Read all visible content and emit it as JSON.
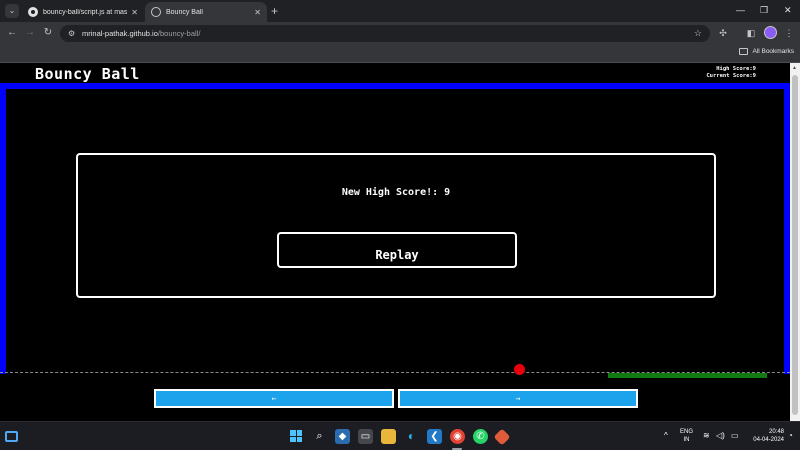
{
  "browser": {
    "tabs": [
      {
        "title": "bouncy-ball/script.js at master",
        "active": false,
        "favicon": "github-icon"
      },
      {
        "title": "Bouncy Ball",
        "active": true,
        "favicon": "globe-icon"
      }
    ],
    "address": {
      "host": "mrinal-pathak.github.io",
      "path": "/bouncy-ball/"
    },
    "bookmarks_label": "All Bookmarks"
  },
  "game": {
    "title": "Bouncy Ball",
    "high_score_text": "High Score:9",
    "current_score_text": "Current Score:9",
    "modal_message": "New High Score!: 9",
    "replay_label": "Replay",
    "left_button_label": "←",
    "right_button_label": "→",
    "colors": {
      "border": "#0000ff",
      "ball": "#e8000b",
      "paddle": "#117a11",
      "buttons": "#1ca3ec"
    }
  },
  "taskbar": {
    "language": "ENG",
    "region": "IN",
    "time": "20:48",
    "date": "04-04-2024"
  }
}
